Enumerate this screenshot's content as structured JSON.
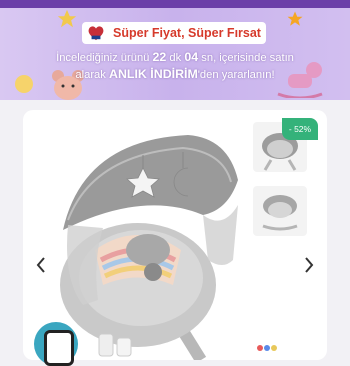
{
  "promo": {
    "title": "Süper Fiyat, Süper Fırsat",
    "line1_pre": "İncelediğiniz ürünü ",
    "minutes": "22",
    "line1_dk": " dk ",
    "seconds": "04",
    "line1_post": " sn, içerisinde satın",
    "line2_pre": "alarak ",
    "line2_bold": "ANLIK İNDİRİM",
    "line2_post": "'den yararlanın!",
    "colors": {
      "title": "#d63a2b",
      "banner_top": "#d9c8f2",
      "shelf": "#6b3fa8"
    }
  },
  "product": {
    "discount_badge": "- 52%",
    "prev_icon": "chevron-left-icon",
    "next_icon": "chevron-right-icon",
    "badge_color": "#34b27a"
  }
}
